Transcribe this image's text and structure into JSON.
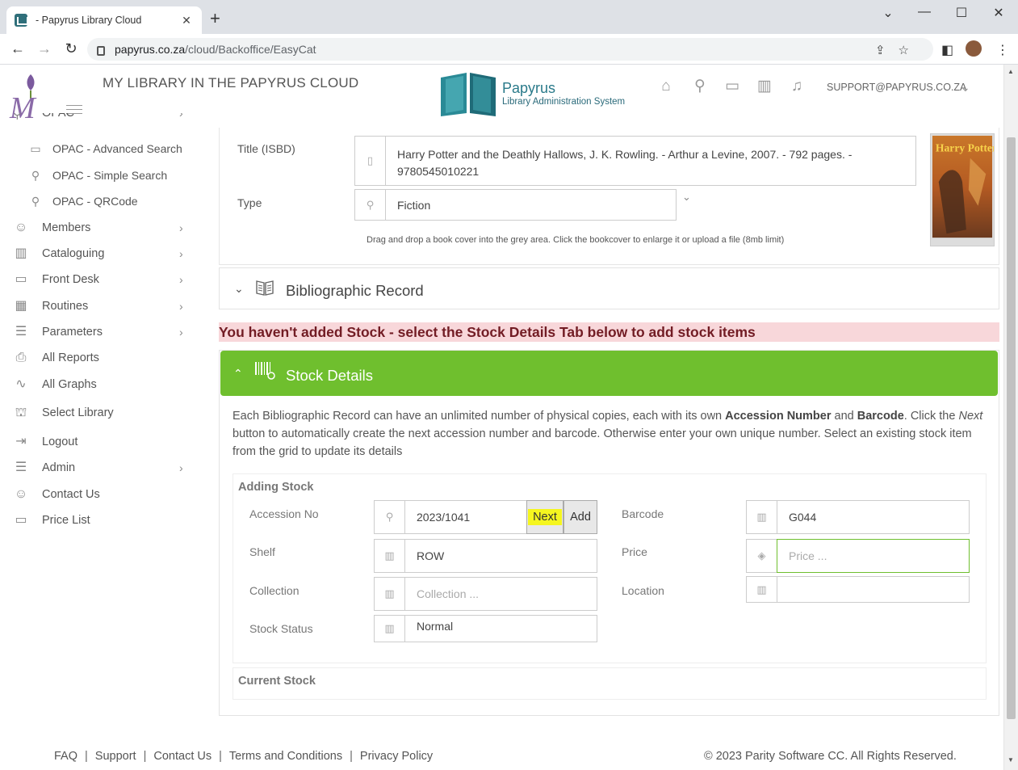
{
  "browser": {
    "tab_title": "- Papyrus Library Cloud",
    "tab_close": "✕",
    "new_tab": "+",
    "url_host": "papyrus.co.za",
    "url_path": "/cloud/Backoffice/EasyCat"
  },
  "header": {
    "site_title": "MY LIBRARY IN THE PAPYRUS CLOUD",
    "brand_name": "Papyrus",
    "brand_sub": "Library Administration System",
    "support_email": "SUPPORT@PAPYRUS.CO.ZA"
  },
  "sidebar": {
    "opac_cut": "OPAC",
    "sub_items": [
      {
        "label": "OPAC - Advanced Search",
        "icon": "monitor-icon"
      },
      {
        "label": "OPAC - Simple Search",
        "icon": "search-icon"
      },
      {
        "label": "OPAC - QRCode",
        "icon": "search-icon"
      }
    ],
    "items": [
      {
        "label": "Members",
        "icon": "members-icon",
        "has_children": true
      },
      {
        "label": "Cataloguing",
        "icon": "book-icon",
        "has_children": true
      },
      {
        "label": "Front Desk",
        "icon": "desk-icon",
        "has_children": true
      },
      {
        "label": "Routines",
        "icon": "calendar-icon",
        "has_children": true
      },
      {
        "label": "Parameters",
        "icon": "list-icon",
        "has_children": true
      },
      {
        "label": "All Reports",
        "icon": "printer-icon",
        "has_children": false
      },
      {
        "label": "All Graphs",
        "icon": "graph-icon",
        "has_children": false
      },
      {
        "label": "Select Library",
        "icon": "library-icon",
        "has_children": false
      },
      {
        "label": "Logout",
        "icon": "logout-icon",
        "has_children": false
      },
      {
        "label": "Admin",
        "icon": "database-icon",
        "has_children": true
      },
      {
        "label": "Contact Us",
        "icon": "user-icon",
        "has_children": false
      },
      {
        "label": "Price List",
        "icon": "wallet-icon",
        "has_children": false
      }
    ]
  },
  "record": {
    "title_label": "Title (ISBD)",
    "title_value_line1": "Harry Potter and the Deathly Hallows, J. K. Rowling. - Arthur a Levine, 2007. - 792 pages. -",
    "title_value_line2": "9780545010221",
    "type_label": "Type",
    "type_value": "Fiction",
    "cover_hint": "Drag and drop a book cover into the grey area. Click the bookcover to enlarge it or upload a file (8mb limit)"
  },
  "bib_panel": {
    "title": "Bibliographic Record"
  },
  "alert": {
    "text": "You haven't added Stock - select the Stock Details Tab below to add stock items"
  },
  "stock": {
    "title": "Stock Details",
    "desc_part1": "Each Bibliographic Record can have an unlimited number of physical copies, each with its own ",
    "desc_bold1": "Accession Number",
    "desc_and": " and ",
    "desc_bold2": "Barcode",
    "desc_part2": ". Click the ",
    "desc_italic": "Next",
    "desc_part3": " button to automatically create the next accession number and barcode. Otherwise enter your own unique number. Select an existing stock item from the grid to update its details",
    "adding_title": "Adding Stock",
    "accession_label": "Accession No",
    "accession_value": "2023/1041",
    "next_label": "Next",
    "add_label": "Add",
    "barcode_label": "Barcode",
    "barcode_value": "G044",
    "shelf_label": "Shelf",
    "shelf_value": "ROW",
    "price_label": "Price",
    "price_placeholder": "Price ...",
    "collection_label": "Collection",
    "collection_placeholder": "Collection ...",
    "location_label": "Location",
    "location_value": "",
    "status_label": "Stock Status",
    "status_value": "Normal",
    "current_title": "Current Stock"
  },
  "footer": {
    "links": [
      "FAQ",
      "Support",
      "Contact Us",
      "Terms and Conditions",
      "Privacy Policy"
    ],
    "copyright": "© 2023 Parity Software CC. All Rights Reserved."
  },
  "colors": {
    "accent_green": "#6fbf2e",
    "alert_bg": "#f8d7da",
    "alert_text": "#721c24",
    "brand_teal": "#2a7a8a",
    "next_highlight": "#f5f61f"
  }
}
